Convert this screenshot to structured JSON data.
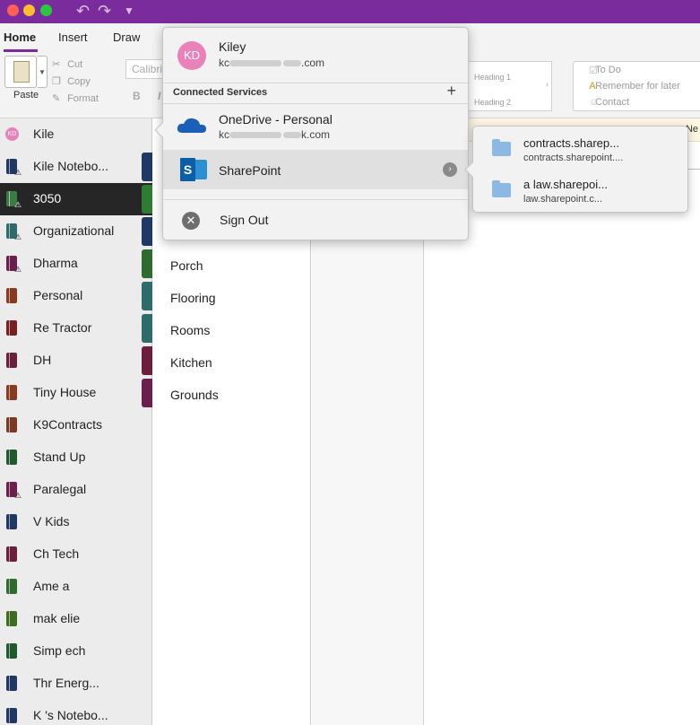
{
  "window": {
    "controls": [
      "close",
      "minimize",
      "zoom"
    ],
    "toolbar_icons": [
      "undo-icon",
      "redo-icon",
      "customize-toolbar-icon"
    ]
  },
  "ribbon": {
    "tabs": [
      {
        "label": "Home",
        "active": true
      },
      {
        "label": "Insert",
        "active": false
      },
      {
        "label": "Draw",
        "active": false
      }
    ],
    "paste_label": "Paste",
    "clipboard": [
      "Cut",
      "Copy",
      "Format"
    ],
    "font_name": "Calibri",
    "bold_label": "B",
    "italic_label": "I",
    "styles": [
      "Heading 1",
      "Heading 2"
    ],
    "tags": [
      "To Do",
      "Remember for later",
      "Contact"
    ],
    "info_tail": "Ne"
  },
  "notebooks": {
    "account_initials": "KD",
    "account_name": "Kile",
    "items": [
      {
        "label": "Kile      Notebo...",
        "color": "#1f3864",
        "warning": true,
        "selected": false
      },
      {
        "label": "3050",
        "color": "#3a7d44",
        "warning": true,
        "selected": true
      },
      {
        "label": "Organizational",
        "color": "#2e6b6b",
        "warning": true,
        "selected": false
      },
      {
        "label": "Dharma",
        "color": "#6b1f4c",
        "warning": true,
        "selected": false
      },
      {
        "label": "Personal",
        "color": "#8a3a1e",
        "warning": false,
        "selected": false
      },
      {
        "label": "Re  Tractor",
        "color": "#7a1f1f",
        "warning": false,
        "selected": false
      },
      {
        "label": "DH",
        "color": "#6b1f3c",
        "warning": false,
        "selected": false
      },
      {
        "label": "Tiny House",
        "color": "#8a3a1e",
        "warning": false,
        "selected": false
      },
      {
        "label": "K9Contracts",
        "color": "#7a3a24",
        "warning": false,
        "selected": false
      },
      {
        "label": "Stand Up",
        "color": "#1f5a2e",
        "warning": false,
        "selected": false
      },
      {
        "label": "Paralegal",
        "color": "#6b1f4c",
        "warning": true,
        "selected": false
      },
      {
        "label": "V   Kids",
        "color": "#1f3864",
        "warning": false,
        "selected": false
      },
      {
        "label": "Ch    Tech",
        "color": "#6b1f3c",
        "warning": false,
        "selected": false
      },
      {
        "label": "Ame  a",
        "color": "#2e6b2e",
        "warning": false,
        "selected": false
      },
      {
        "label": "mak       elie",
        "color": "#3d6b1f",
        "warning": false,
        "selected": false
      },
      {
        "label": "Simp     ech",
        "color": "#1f5a2e",
        "warning": false,
        "selected": false
      },
      {
        "label": "Thr          Energ...",
        "color": "#1f3864",
        "warning": false,
        "selected": false
      },
      {
        "label": "K   's Notebo...",
        "color": "#1f3864",
        "warning": false,
        "selected": false
      }
    ],
    "strip_colors": [
      "#1f3864",
      "#2e7d32",
      "#1f3864",
      "#2e6b2e",
      "#2e6b6b",
      "#2e6b6b",
      "#6b1f3c",
      "#6b1f4c"
    ]
  },
  "sections": [
    "Porch",
    "Flooring",
    "Rooms",
    "Kitchen",
    "Grounds"
  ],
  "account_popover": {
    "avatar_initials": "KD",
    "name": "Kiley",
    "email_start": "kc",
    "email_end": ".com",
    "connected_services_label": "Connected Services",
    "add_label": "+",
    "services": [
      {
        "name": "OneDrive - Personal",
        "sub_start": "kc",
        "sub_end": "k.com"
      },
      {
        "name": "SharePoint",
        "sub_start": "",
        "sub_end": ""
      }
    ],
    "sign_out_label": "Sign Out"
  },
  "sharepoint_sites": [
    {
      "title": "contracts.sharep...",
      "url": "contracts.sharepoint...."
    },
    {
      "title": "a         law.sharepoi...",
      "url": "law.sharepoint.c..."
    }
  ]
}
